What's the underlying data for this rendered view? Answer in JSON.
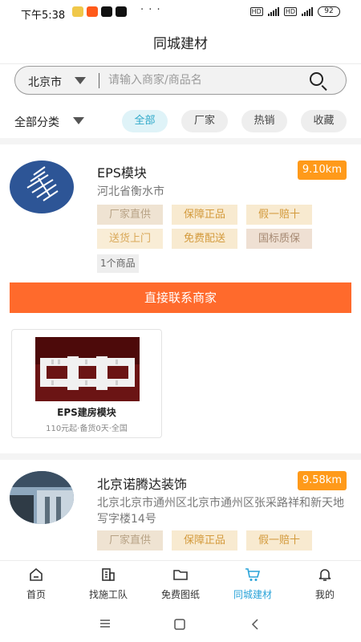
{
  "status_bar": {
    "time": "下午5:38",
    "battery": "92",
    "dots": "· · ·"
  },
  "header": {
    "title": "同城建材"
  },
  "search": {
    "city": "北京市",
    "placeholder": "请输入商家/商品名"
  },
  "filters": {
    "category": "全部分类",
    "chips": [
      {
        "label": "全部",
        "active": true
      },
      {
        "label": "厂家",
        "active": false
      },
      {
        "label": "热销",
        "active": false
      },
      {
        "label": "收藏",
        "active": false
      }
    ]
  },
  "shops": [
    {
      "name": "EPS模块",
      "distance": "9.10km",
      "address": "河北省衡水市",
      "tags": [
        "厂家直供",
        "保障正品",
        "假一赔十",
        "送货上门",
        "免费配送",
        "国标质保"
      ],
      "product_count": "1个商品",
      "contact_label": "直接联系商家",
      "products": [
        {
          "name": "EPS建房模块",
          "meta": "110元起·备货0天·全国"
        }
      ]
    },
    {
      "name": "北京诺腾达装饰",
      "distance": "9.58km",
      "address": "北京北京市通州区北京市通州区张采路祥和新天地写字楼14号",
      "tags": [
        "厂家直供",
        "保障正品",
        "假一赔十"
      ]
    }
  ],
  "tabs": [
    {
      "label": "首页",
      "icon": "home-icon"
    },
    {
      "label": "找施工队",
      "icon": "building-icon"
    },
    {
      "label": "免费图纸",
      "icon": "folder-icon"
    },
    {
      "label": "同城建材",
      "icon": "cart-icon",
      "active": true
    },
    {
      "label": "我的",
      "icon": "bell-icon"
    }
  ],
  "colors": {
    "accent": "#2aa3d8",
    "contact_button": "#ff6a2c",
    "distance_badge": "#ff9a1a"
  }
}
